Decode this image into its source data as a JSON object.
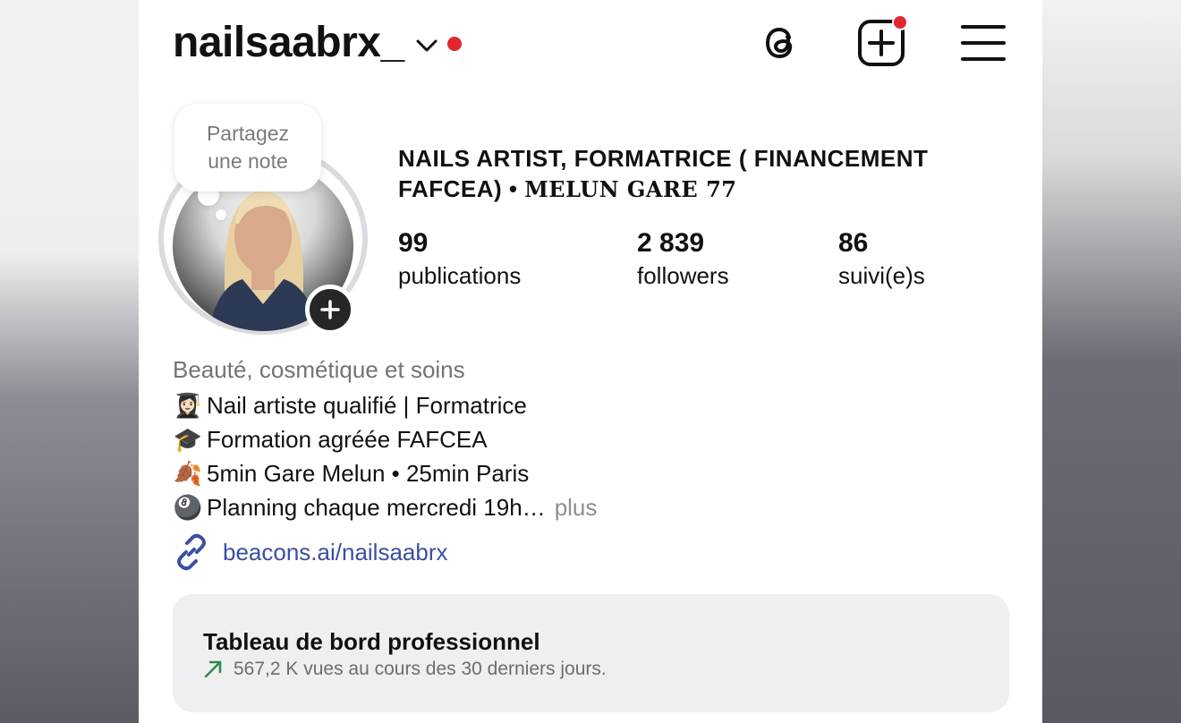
{
  "header": {
    "username": "nailsaabrx_"
  },
  "note": {
    "line1": "Partagez",
    "line2": "une note"
  },
  "profile": {
    "name_part1": "NAILS ARTIST, FORMATRICE ( FINANCEMENT FAFCEA) •",
    "name_part2": "MELUN GARE 77",
    "stats": {
      "posts_count": "99",
      "posts_label": "publications",
      "followers_count": "2 839",
      "followers_label": "followers",
      "following_count": "86",
      "following_label": "suivi(e)s"
    }
  },
  "bio": {
    "category": "Beauté, cosmétique et soins",
    "lines": [
      {
        "emoji": "👩🏻‍🎓",
        "text": "Nail artiste qualifié | Formatrice"
      },
      {
        "emoji": "🎓",
        "text": "Formation agréée FAFCEA"
      },
      {
        "emoji": "🍂",
        "text": "5min Gare Melun • 25min Paris"
      },
      {
        "emoji": "🎱",
        "text": "Planning chaque mercredi 19h…"
      }
    ],
    "more_label": "plus",
    "link": "beacons.ai/nailsaabrx"
  },
  "dashboard": {
    "title": "Tableau de bord professionnel",
    "subtitle": "567,2 K vues au cours des 30 derniers jours."
  },
  "colors": {
    "notification_red": "#e1262f",
    "link_blue": "#3b4ea6",
    "trend_green": "#2e8b4a"
  },
  "icons": [
    "chevron-down-icon",
    "threads-icon",
    "new-post-icon",
    "menu-icon",
    "add-story-icon",
    "link-icon",
    "trend-up-icon"
  ]
}
